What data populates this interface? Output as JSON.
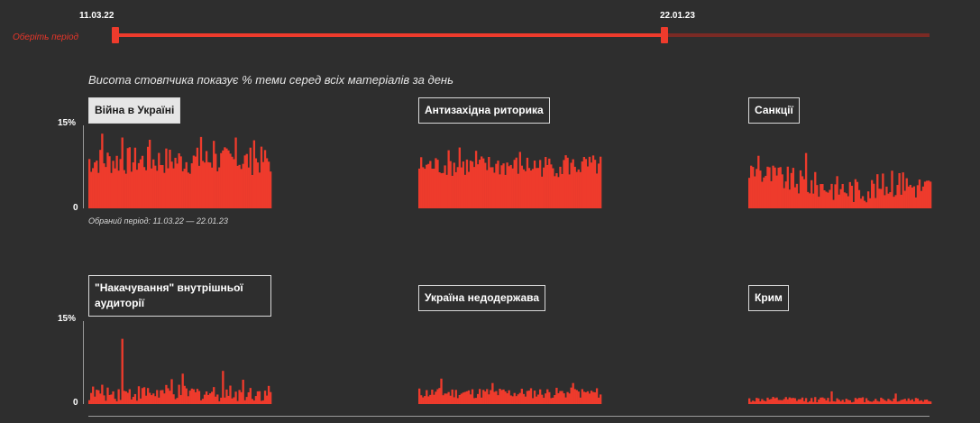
{
  "slider": {
    "start_label": "11.03.22",
    "end_label": "22.01.23",
    "period_label": "Оберіть період"
  },
  "subtitle": "Висота стовпчика показує % теми серед всіх матеріалів за день",
  "selected_period_caption": "Обраний період: 11.03.22 — 22.01.23",
  "y_ticks": {
    "top": "15%",
    "bottom": "0"
  },
  "colors": {
    "bar": "#ee3b2c",
    "background": "#2e2e2e",
    "track_inactive": "#7a2a24"
  },
  "topics": [
    {
      "label": "Війна в Україні",
      "active": true
    },
    {
      "label": "Антизахідна риторика",
      "active": false
    },
    {
      "label": "Санкції",
      "active": false
    },
    {
      "label": "\"Накачування\" внутрішньої аудиторії",
      "active": false
    },
    {
      "label": "Україна недодержава",
      "active": false
    },
    {
      "label": "Крим",
      "active": false
    }
  ],
  "chart_data": [
    {
      "type": "bar",
      "title": "Війна в Україні",
      "ylim": [
        0,
        15
      ],
      "unit": "%",
      "bins": 100,
      "base": 8.6,
      "noise": 2.6,
      "spikes": [
        [
          7,
          13.5
        ],
        [
          18,
          12.8
        ],
        [
          33,
          12.4
        ],
        [
          61,
          12.9
        ],
        [
          68,
          12.2
        ],
        [
          80,
          12.8
        ],
        [
          90,
          12.3
        ]
      ],
      "start_date": "11.03.22",
      "end_date": "22.01.23"
    },
    {
      "type": "bar",
      "title": "Антизахідна риторика",
      "ylim": [
        0,
        15
      ],
      "unit": "%",
      "bins": 100,
      "base": 7.6,
      "noise": 2.0,
      "spikes": [
        [
          16,
          10.5
        ],
        [
          22,
          11.0
        ],
        [
          31,
          10.4
        ],
        [
          55,
          10.2
        ],
        [
          80,
          9.6
        ]
      ],
      "start_date": "11.03.22",
      "end_date": "22.01.23"
    },
    {
      "type": "bar",
      "title": "Санкції",
      "ylim": [
        0,
        15
      ],
      "unit": "%",
      "bins": 100,
      "base": 4.4,
      "noise": 2.4,
      "trend": [
        [
          0,
          6.8
        ],
        [
          30,
          4.5
        ],
        [
          60,
          3.2
        ],
        [
          80,
          4.5
        ],
        [
          100,
          3.6
        ]
      ],
      "spikes": [
        [
          5,
          9.5
        ],
        [
          31,
          10.0
        ],
        [
          78,
          6.8
        ],
        [
          84,
          6.5
        ]
      ],
      "start_date": "11.03.22",
      "end_date": "22.01.23"
    },
    {
      "type": "bar",
      "title": "\"Накачування\" внутрішньої аудиторії",
      "ylim": [
        0,
        15
      ],
      "unit": "%",
      "bins": 100,
      "base": 2.0,
      "noise": 1.5,
      "spikes": [
        [
          18,
          11.8
        ],
        [
          73,
          6.0
        ],
        [
          51,
          5.5
        ],
        [
          45,
          4.5
        ],
        [
          84,
          4.4
        ]
      ],
      "start_date": "11.03.22",
      "end_date": "22.01.23"
    },
    {
      "type": "bar",
      "title": "Україна недодержава",
      "ylim": [
        0,
        15
      ],
      "unit": "%",
      "bins": 100,
      "base": 2.0,
      "noise": 1.0,
      "spikes": [
        [
          12,
          4.6
        ],
        [
          40,
          3.8
        ],
        [
          84,
          3.8
        ]
      ],
      "start_date": "11.03.22",
      "end_date": "22.01.23"
    },
    {
      "type": "bar",
      "title": "Крим",
      "ylim": [
        0,
        15
      ],
      "unit": "%",
      "bins": 100,
      "base": 0.8,
      "noise": 0.5,
      "spikes": [
        [
          45,
          2.3
        ],
        [
          80,
          1.9
        ]
      ],
      "start_date": "11.03.22",
      "end_date": "22.01.23"
    }
  ]
}
